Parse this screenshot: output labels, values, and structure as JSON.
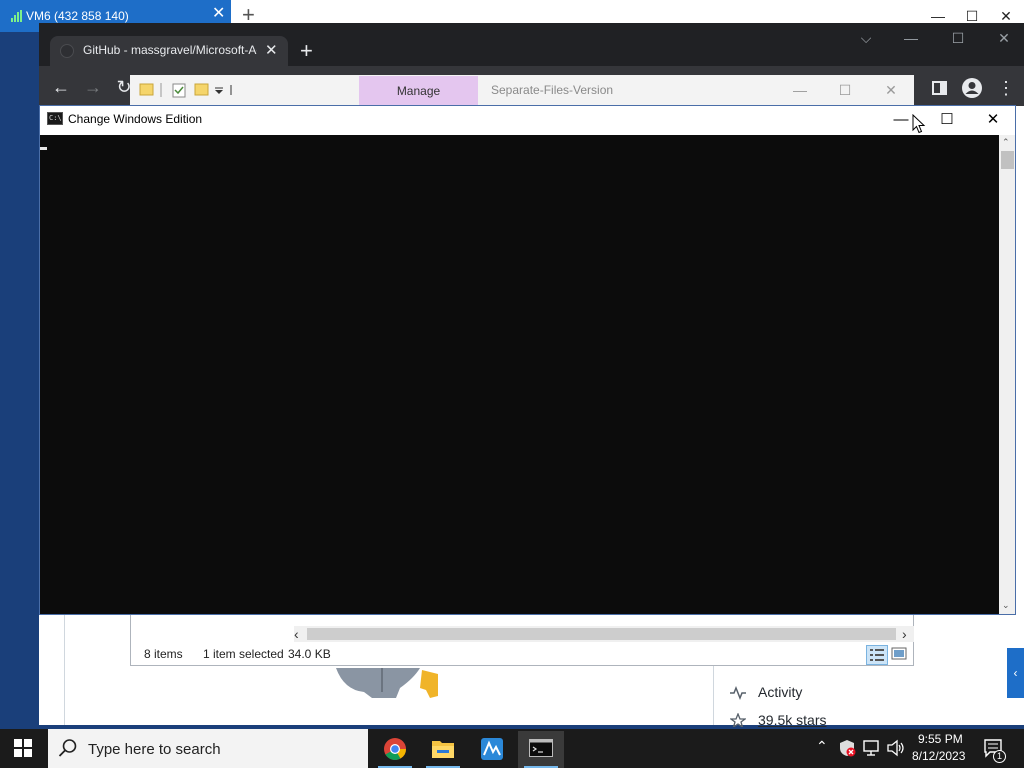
{
  "rdp": {
    "tab_title": "VM6 (432 858 140)",
    "close_glyph": "✕",
    "new_tab_glyph": "+",
    "minimize_glyph": "—",
    "maximize_glyph": "☐",
    "close_window_glyph": "✕"
  },
  "chrome": {
    "tab_title": "GitHub - massgravel/Microsoft-Activation-Scripts",
    "tab_close": "✕",
    "new_tab": "+",
    "dropdown_glyph": "⌵",
    "minimize": "—",
    "maximize": "☐",
    "close": "✕",
    "back": "←",
    "forward": "→",
    "reload": "↻",
    "sidebar_icon": "sidebar-icon",
    "profile_icon": "profile-icon",
    "menu": "⋮"
  },
  "explorer": {
    "manage_tab": "Manage",
    "window_name": "Separate-Files-Version",
    "minimize": "—",
    "maximize": "☐",
    "close": "✕",
    "status": {
      "items": "8 items",
      "selected": "1 item selected",
      "size": "34.0 KB"
    },
    "scroll_left": "‹",
    "scroll_right": "›"
  },
  "github": {
    "activity": "Activity",
    "stars": "39.5k stars",
    "side_arrow": "‹"
  },
  "console": {
    "title": "Change Windows Edition",
    "icon_text": "C:\\",
    "minimize": "—",
    "maximize": "☐",
    "close": "✕",
    "scroll_up": "⌃",
    "scroll_down": "⌄"
  },
  "taskbar": {
    "search_placeholder": "Type here to search",
    "apps": [
      "chrome-icon",
      "file-explorer-icon",
      "azure-data-studio-icon",
      "command-prompt-icon"
    ],
    "tray_up": "⌃",
    "time": "9:55 PM",
    "date": "8/12/2023",
    "notification_count": "1"
  }
}
